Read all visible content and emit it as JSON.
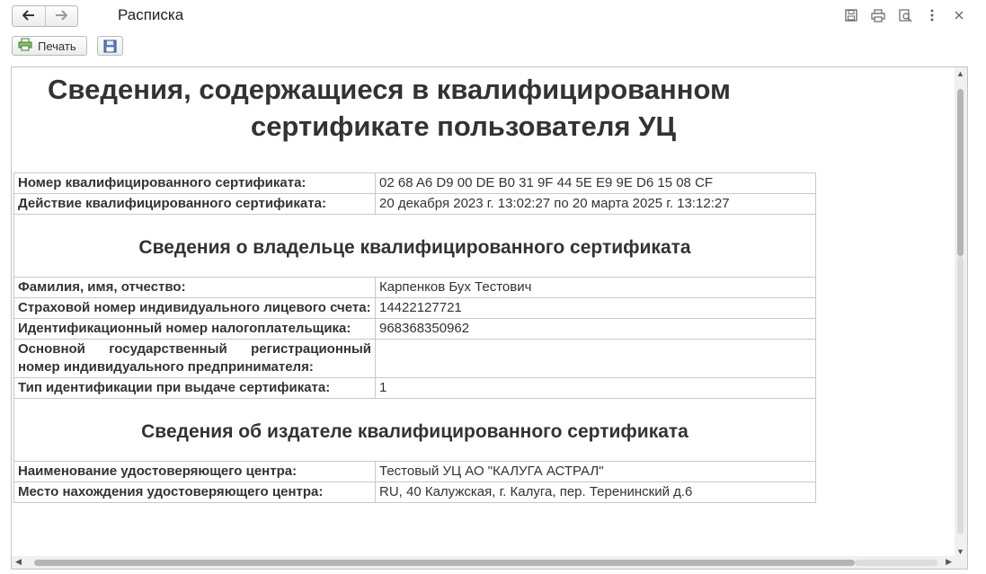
{
  "window": {
    "title": "Расписка",
    "back_icon": "arrow-left-icon",
    "forward_icon": "arrow-right-icon"
  },
  "toolbar": {
    "print_label": "Печать",
    "save_icon": "floppy-disk-icon"
  },
  "document": {
    "title_line1": "Сведения, содержащиеся в квалифицированном",
    "title_line2": "сертификате пользователя УЦ",
    "cert_number_label": "Номер квалифицированного сертификата:",
    "cert_number_value": "02 68 A6 D9 00 DE B0 31 9F 44 5E E9 9E D6 15 08 CF",
    "validity_label": "Действие квалифицированного сертификата:",
    "validity_value": "20 декабря 2023 г. 13:02:27 по 20 марта 2025 г. 13:12:27",
    "owner_section": "Сведения о владельце квалифицированного сертификата",
    "owner_rows": [
      {
        "label": "Фамилия, имя, отчество:",
        "value": "Карпенков Бух Тестович"
      },
      {
        "label": "Страховой номер индивидуального лицевого счета:",
        "value": "14422127721"
      },
      {
        "label": "Идентификационный номер налогоплательщика:",
        "value": "968368350962"
      },
      {
        "label": "Основной государственный регистрационный номер индивидуального предпринимателя:",
        "value": ""
      },
      {
        "label": "Тип идентификации при выдаче сертификата:",
        "value": "1"
      }
    ],
    "issuer_section": "Сведения об издателе квалифицированного сертификата",
    "issuer_rows": [
      {
        "label": "Наименование удостоверяющего центра:",
        "value": "Тестовый УЦ АО \"КАЛУГА АСТРАЛ\""
      },
      {
        "label": "Место нахождения удостоверяющего центра:",
        "value": "RU, 40 Калужская, г. Калуга, пер. Теренинский д.6"
      }
    ]
  }
}
